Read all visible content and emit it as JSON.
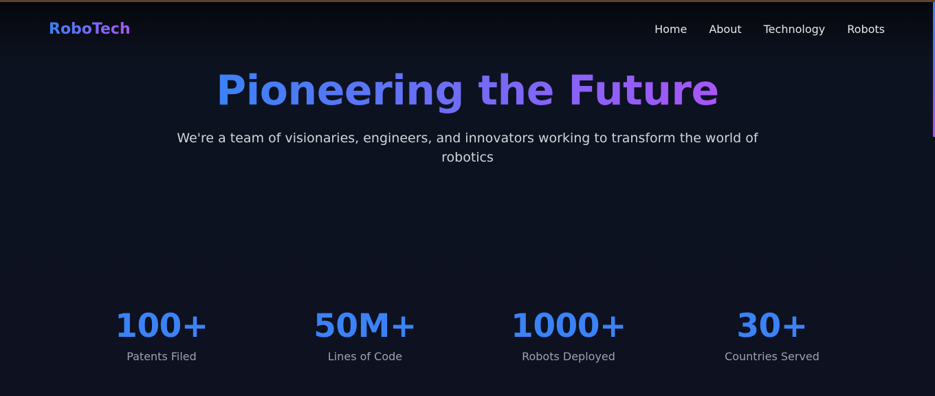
{
  "app": {
    "logo": "RoboTech"
  },
  "nav": {
    "items": [
      {
        "label": "Home"
      },
      {
        "label": "About"
      },
      {
        "label": "Technology"
      },
      {
        "label": "Robots"
      }
    ]
  },
  "hero": {
    "title": "Pioneering the Future",
    "subtitle": "We're a team of visionaries, engineers, and innovators working to transform the world of robotics"
  },
  "stats": [
    {
      "value": "100+",
      "label": "Patents Filed"
    },
    {
      "value": "50M+",
      "label": "Lines of Code"
    },
    {
      "value": "1000+",
      "label": "Robots Deployed"
    },
    {
      "value": "30+",
      "label": "Countries Served"
    }
  ],
  "colors": {
    "background": "#0d1120",
    "accent_blue": "#3b82f6",
    "accent_purple": "#a855f7",
    "text_primary": "#e5e7eb",
    "text_muted": "#9ca3af"
  }
}
